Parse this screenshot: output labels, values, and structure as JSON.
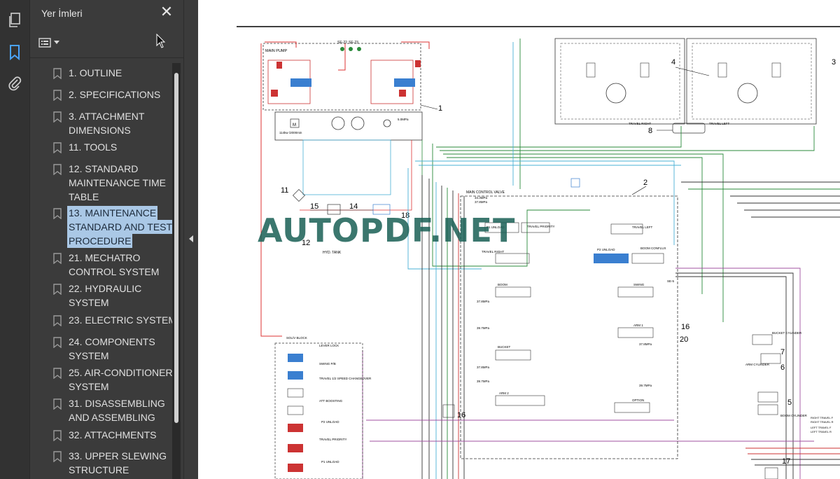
{
  "sidebar": {
    "title": "Yer İmleri",
    "bookmarks": [
      {
        "label": "1. OUTLINE"
      },
      {
        "label": "2. SPECIFICATIONS"
      },
      {
        "label": "3. ATTACHMENT DIMENSIONS",
        "l1": "3. ATTACHMENT",
        "l2": "DIMENSIONS"
      },
      {
        "label": "11. TOOLS"
      },
      {
        "label": "12. STANDARD MAINTENANCE TIME TABLE",
        "l1": "12. STANDARD",
        "l2": "MAINTENANCE TIME",
        "l3": "TABLE"
      },
      {
        "label": "13. MAINTENANCE STANDARD AND TEST PROCEDURE",
        "l1": "13. MAINTENANCE",
        "l2": "STANDARD AND TEST",
        "l3": "PROCEDURE",
        "selected": true
      },
      {
        "label": "21. MECHATRO CONTROL SYSTEM",
        "l1": "21. MECHATRO",
        "l2": "CONTROL SYSTEM"
      },
      {
        "label": "22. HYDRAULIC SYSTEM",
        "l1": "22. HYDRAULIC",
        "l2": "SYSTEM"
      },
      {
        "label": "23. ELECTRIC SYSTEM"
      },
      {
        "label": "24. COMPONENTS SYSTEM",
        "l1": "24. COMPONENTS",
        "l2": "SYSTEM"
      },
      {
        "label": "25. AIR-CONDITIONER SYSTEM",
        "l1": "25. AIR-CONDITIONER",
        "l2": "SYSTEM"
      },
      {
        "label": "31. DISASSEMBLING AND ASSEMBLING",
        "l1": "31. DISASSEMBLING",
        "l2": "AND ASSEMBLING"
      },
      {
        "label": "32. ATTACHMENTS"
      },
      {
        "label": "33. UPPER SLEWING STRUCTURE",
        "l1": "33. UPPER SLEWING",
        "l2": "STRUCTURE"
      }
    ]
  },
  "document": {
    "watermark": "AUTOPDF.NET",
    "labels": {
      "main_pump": "MAIN PUMP",
      "main_control_valve": "MAIN CONTROL VALVE",
      "travel_right": "TRAVEL RIGHT",
      "travel_left": "TRAVEL LEFT",
      "travel_priority": "TRAVEL PRIORITY",
      "p1_unload": "P1 UNLOAD",
      "p2_unload": "P2 UNLOAD",
      "boom": "BOOM",
      "boom_conflux": "BOOM CONFLUX",
      "swing": "SWING",
      "arm1": "ARM 1",
      "arm2": "ARM 2",
      "bucket": "BUCKET",
      "option": "OPTION",
      "solv_block": "SOL/V BLOCK",
      "hyd_tank": "HYD. TANK",
      "bucket_cylinder": "BUCKET CYLINDER",
      "arm_cylinder": "ARM CYLINDER",
      "boom_cylinder": "BOOM CYLINDER",
      "lever_lock": "LEVER LOCK",
      "swing_pb": "SWING P/B",
      "travel_speed": "TRAVEL 1/2 SPEED CHANGEOVER",
      "att_boosting": "ATT BOOSTING",
      "p2_unload_sol": "P2 UNLOAD",
      "travel_priority_sol": "TRAVEL PRIORITY",
      "p1_unload_sol": "P1 UNLOAD",
      "right_travel_1": "RIGHT TRAVEL F",
      "right_travel_2": "RIGHT TRAVEL R",
      "left_travel_1": "LEFT TRAVEL F",
      "left_travel_2": "LEFT TRAVEL R",
      "p37_8": "37.8MPa",
      "p39_7": "39.7MPa",
      "p34": "34.3MPa",
      "p5": "5.0MPa",
      "se22": "SE-22",
      "se23": "SE-23",
      "se5": "SE-5",
      "motor_spec": "114kw /2000min",
      "cmp1": "1",
      "cmp2": "2",
      "cmp3": "3",
      "cmp4": "4",
      "cmp5": "5",
      "cmp6": "6",
      "cmp7": "7",
      "cmp8": "8",
      "cmp11": "11",
      "cmp12": "12",
      "cmp14": "14",
      "cmp15": "15",
      "cmp16": "16",
      "cmp17": "17",
      "cmp18": "18",
      "cmp20": "20"
    }
  }
}
